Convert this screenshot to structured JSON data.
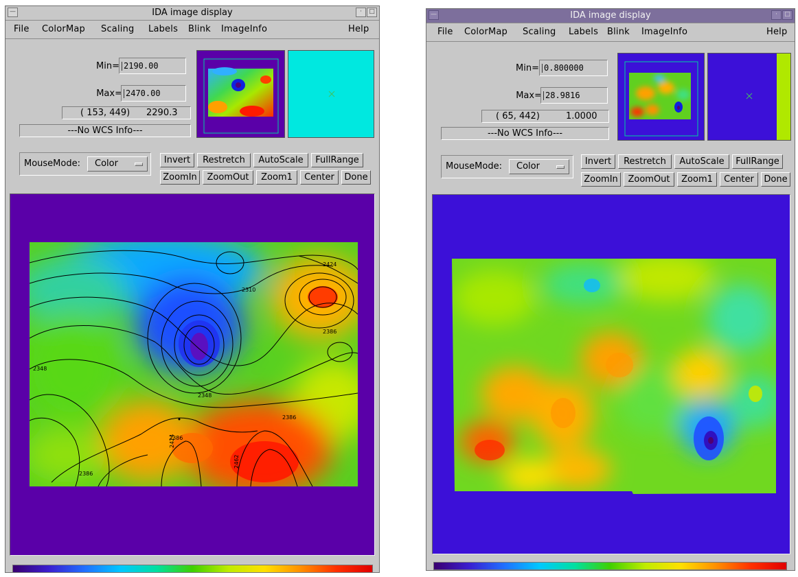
{
  "window_left": {
    "title": "IDA image display",
    "menu": [
      "File",
      "ColorMap",
      "Scaling",
      "Labels",
      "Blink",
      "ImageInfo"
    ],
    "help": "Help",
    "min_label": "Min=",
    "min_value": "2190.00",
    "max_label": "Max=",
    "max_value": "2470.00",
    "cursor_coords": "( 153, 449)",
    "cursor_value": "2290.3",
    "wcs": "---No WCS Info---",
    "mousemode_label": "MouseMode:",
    "mousemode_value": "Color",
    "buttons_row1": [
      "Invert",
      "Restretch",
      "AutoScale",
      "FullRange"
    ],
    "buttons_row2": [
      "ZoomIn",
      "ZoomOut",
      "Zoom1",
      "Center",
      "Done"
    ],
    "contour_labels": [
      "2424",
      "2310",
      "2386",
      "2348",
      "2348",
      "2386",
      "2386",
      "2424",
      "2462",
      "2386"
    ]
  },
  "window_right": {
    "title": "IDA image display",
    "menu": [
      "File",
      "ColorMap",
      "Scaling",
      "Labels",
      "Blink",
      "ImageInfo"
    ],
    "help": "Help",
    "min_label": "Min=",
    "min_value": "0.800000",
    "max_label": "Max=",
    "max_value": "28.9816",
    "cursor_coords": "( 65, 442)",
    "cursor_value": "1.0000",
    "wcs": "---No WCS Info---",
    "mousemode_label": "MouseMode:",
    "mousemode_value": "Color",
    "buttons_row1": [
      "Invert",
      "Restretch",
      "AutoScale",
      "FullRange"
    ],
    "buttons_row2": [
      "ZoomIn",
      "ZoomOut",
      "Zoom1",
      "Center",
      "Done"
    ]
  },
  "colors": {
    "window_bg": "#c8c8c8",
    "image_bg_left": "#5a00a8",
    "image_bg_right": "#3c10d8",
    "magnifier_left": "#00e8e0",
    "title_active": "#7d6f9c"
  }
}
